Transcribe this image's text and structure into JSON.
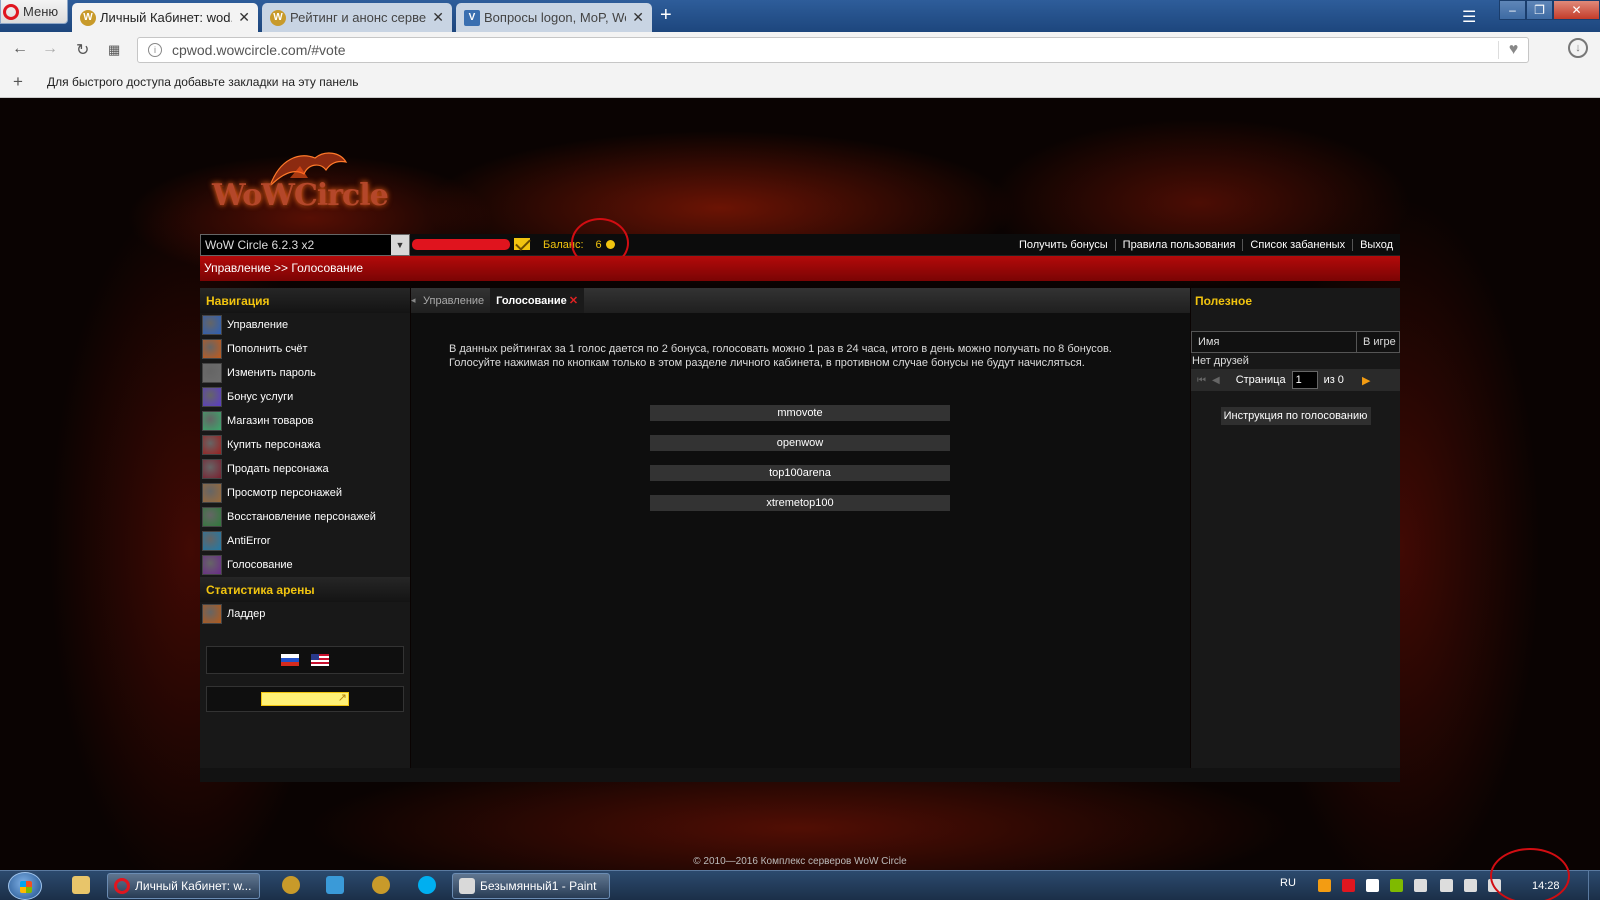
{
  "browser": {
    "menu_label": "Меню",
    "tabs": [
      {
        "title": "Личный Кабинет: wod.wo",
        "favicon": "wow-icon",
        "active": true
      },
      {
        "title": "Рейтинг и анонс серверо",
        "favicon": "wow-icon",
        "active": false
      },
      {
        "title": "Вопросы logon, MoP, Wo",
        "favicon": "forum-icon",
        "active": false
      }
    ],
    "url": "cpwod.wowcircle.com/#vote",
    "bookmarks_hint": "Для быстрого доступа добавьте закладки на эту панель"
  },
  "site": {
    "realm_select": "WoW Circle 6.2.3 x2",
    "balance_label": "Баланс:",
    "balance_value": "6",
    "top_links": [
      "Получить бонусы",
      "Правила пользования",
      "Список забаненых",
      "Выход"
    ],
    "breadcrumb": "Управление >> Голосование",
    "nav_title": "Навигация",
    "nav_items": [
      {
        "label": "Управление",
        "icon": "frost-spell-icon",
        "color": "#2b5fb8"
      },
      {
        "label": "Пополнить счёт",
        "icon": "fire-claw-icon",
        "color": "#c45a1a"
      },
      {
        "label": "Изменить пароль",
        "icon": "eye-icon",
        "color": "#6d6d6d"
      },
      {
        "label": "Бонус услуги",
        "icon": "lightning-icon",
        "color": "#5a3bc9"
      },
      {
        "label": "Магазин товаров",
        "icon": "orb-icon",
        "color": "#3aa86b"
      },
      {
        "label": "Купить персонажа",
        "icon": "demon-icon",
        "color": "#9a1f1f"
      },
      {
        "label": "Продать персонажа",
        "icon": "demon-hand-icon",
        "color": "#7a1f2f"
      },
      {
        "label": "Просмотр персонажей",
        "icon": "warrior-face-icon",
        "color": "#9a6a3a"
      },
      {
        "label": "Восстановление персонажей",
        "icon": "nature-icon",
        "color": "#2f7a3a"
      },
      {
        "label": "AntiError",
        "icon": "vortex-icon",
        "color": "#1f7aa8"
      },
      {
        "label": "Голосование",
        "icon": "crossed-swords-icon",
        "color": "#6a2a8a"
      }
    ],
    "arena_title": "Статистика арены",
    "arena_items": [
      {
        "label": "Ладдер",
        "icon": "arena-icon",
        "color": "#b45a1a"
      }
    ],
    "content_tabs": [
      "Управление",
      "Голосование"
    ],
    "vote_text_1": "В данных рейтингах за 1 голос дается по 2 бонуса, голосовать можно 1 раз в 24 часа, итого в день можно получать по 8 бонусов.",
    "vote_text_2": "Голосуйте нажимая по кнопкам только в этом разделе личного кабинета, в противном случае бонусы не будут начисляться.",
    "vote_buttons": [
      "mmovote",
      "openwow",
      "top100arena",
      "xtremetop100"
    ],
    "useful_title": "Полезное",
    "friends_col_name": "Имя",
    "friends_col_ingame": "В игре",
    "no_friends": "Нет друзей",
    "pager_label": "Страница",
    "pager_value": "1",
    "pager_of": "из 0",
    "instruction_button": "Инструкция по голосованию",
    "copyright": "© 2010—2016 Комплекс серверов WoW Circle"
  },
  "taskbar": {
    "tasks": [
      "Личный Кабинет: w...",
      "Безымянный1 - Paint"
    ],
    "lang": "RU",
    "clock": "14:28"
  },
  "colors": {
    "accent_gold": "#f1c40f",
    "bar_red": "#b40a0a",
    "annotation_red": "#d10d12"
  }
}
